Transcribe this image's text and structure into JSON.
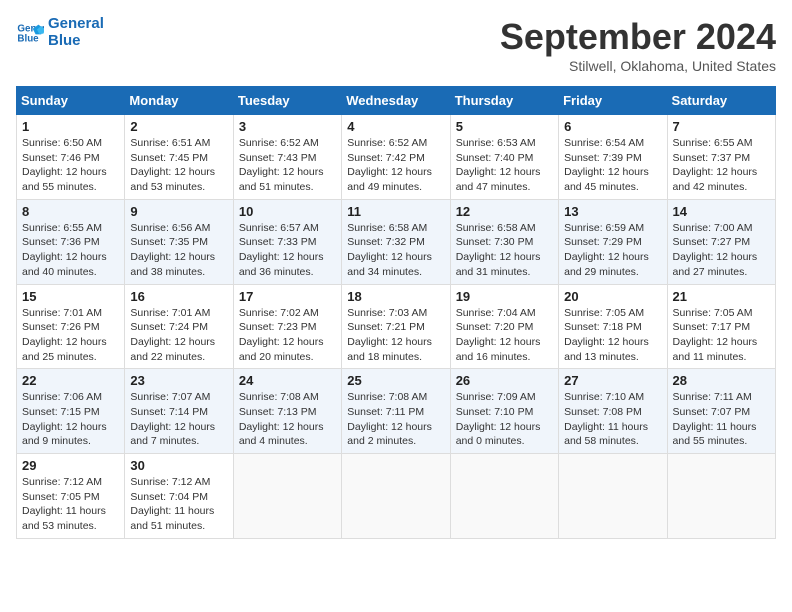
{
  "header": {
    "logo_line1": "General",
    "logo_line2": "Blue",
    "month_title": "September 2024",
    "subtitle": "Stilwell, Oklahoma, United States"
  },
  "calendar": {
    "days_of_week": [
      "Sunday",
      "Monday",
      "Tuesday",
      "Wednesday",
      "Thursday",
      "Friday",
      "Saturday"
    ],
    "weeks": [
      [
        null,
        {
          "day": "2",
          "sunrise": "6:51 AM",
          "sunset": "7:45 PM",
          "daylight": "12 hours and 53 minutes."
        },
        {
          "day": "3",
          "sunrise": "6:52 AM",
          "sunset": "7:43 PM",
          "daylight": "12 hours and 51 minutes."
        },
        {
          "day": "4",
          "sunrise": "6:52 AM",
          "sunset": "7:42 PM",
          "daylight": "12 hours and 49 minutes."
        },
        {
          "day": "5",
          "sunrise": "6:53 AM",
          "sunset": "7:40 PM",
          "daylight": "12 hours and 47 minutes."
        },
        {
          "day": "6",
          "sunrise": "6:54 AM",
          "sunset": "7:39 PM",
          "daylight": "12 hours and 45 minutes."
        },
        {
          "day": "7",
          "sunrise": "6:55 AM",
          "sunset": "7:37 PM",
          "daylight": "12 hours and 42 minutes."
        }
      ],
      [
        {
          "day": "1",
          "sunrise": "6:50 AM",
          "sunset": "7:46 PM",
          "daylight": "12 hours and 55 minutes."
        },
        null,
        null,
        null,
        null,
        null,
        null
      ],
      [
        {
          "day": "8",
          "sunrise": "6:55 AM",
          "sunset": "7:36 PM",
          "daylight": "12 hours and 40 minutes."
        },
        {
          "day": "9",
          "sunrise": "6:56 AM",
          "sunset": "7:35 PM",
          "daylight": "12 hours and 38 minutes."
        },
        {
          "day": "10",
          "sunrise": "6:57 AM",
          "sunset": "7:33 PM",
          "daylight": "12 hours and 36 minutes."
        },
        {
          "day": "11",
          "sunrise": "6:58 AM",
          "sunset": "7:32 PM",
          "daylight": "12 hours and 34 minutes."
        },
        {
          "day": "12",
          "sunrise": "6:58 AM",
          "sunset": "7:30 PM",
          "daylight": "12 hours and 31 minutes."
        },
        {
          "day": "13",
          "sunrise": "6:59 AM",
          "sunset": "7:29 PM",
          "daylight": "12 hours and 29 minutes."
        },
        {
          "day": "14",
          "sunrise": "7:00 AM",
          "sunset": "7:27 PM",
          "daylight": "12 hours and 27 minutes."
        }
      ],
      [
        {
          "day": "15",
          "sunrise": "7:01 AM",
          "sunset": "7:26 PM",
          "daylight": "12 hours and 25 minutes."
        },
        {
          "day": "16",
          "sunrise": "7:01 AM",
          "sunset": "7:24 PM",
          "daylight": "12 hours and 22 minutes."
        },
        {
          "day": "17",
          "sunrise": "7:02 AM",
          "sunset": "7:23 PM",
          "daylight": "12 hours and 20 minutes."
        },
        {
          "day": "18",
          "sunrise": "7:03 AM",
          "sunset": "7:21 PM",
          "daylight": "12 hours and 18 minutes."
        },
        {
          "day": "19",
          "sunrise": "7:04 AM",
          "sunset": "7:20 PM",
          "daylight": "12 hours and 16 minutes."
        },
        {
          "day": "20",
          "sunrise": "7:05 AM",
          "sunset": "7:18 PM",
          "daylight": "12 hours and 13 minutes."
        },
        {
          "day": "21",
          "sunrise": "7:05 AM",
          "sunset": "7:17 PM",
          "daylight": "12 hours and 11 minutes."
        }
      ],
      [
        {
          "day": "22",
          "sunrise": "7:06 AM",
          "sunset": "7:15 PM",
          "daylight": "12 hours and 9 minutes."
        },
        {
          "day": "23",
          "sunrise": "7:07 AM",
          "sunset": "7:14 PM",
          "daylight": "12 hours and 7 minutes."
        },
        {
          "day": "24",
          "sunrise": "7:08 AM",
          "sunset": "7:13 PM",
          "daylight": "12 hours and 4 minutes."
        },
        {
          "day": "25",
          "sunrise": "7:08 AM",
          "sunset": "7:11 PM",
          "daylight": "12 hours and 2 minutes."
        },
        {
          "day": "26",
          "sunrise": "7:09 AM",
          "sunset": "7:10 PM",
          "daylight": "12 hours and 0 minutes."
        },
        {
          "day": "27",
          "sunrise": "7:10 AM",
          "sunset": "7:08 PM",
          "daylight": "11 hours and 58 minutes."
        },
        {
          "day": "28",
          "sunrise": "7:11 AM",
          "sunset": "7:07 PM",
          "daylight": "11 hours and 55 minutes."
        }
      ],
      [
        {
          "day": "29",
          "sunrise": "7:12 AM",
          "sunset": "7:05 PM",
          "daylight": "11 hours and 53 minutes."
        },
        {
          "day": "30",
          "sunrise": "7:12 AM",
          "sunset": "7:04 PM",
          "daylight": "11 hours and 51 minutes."
        },
        null,
        null,
        null,
        null,
        null
      ]
    ]
  }
}
